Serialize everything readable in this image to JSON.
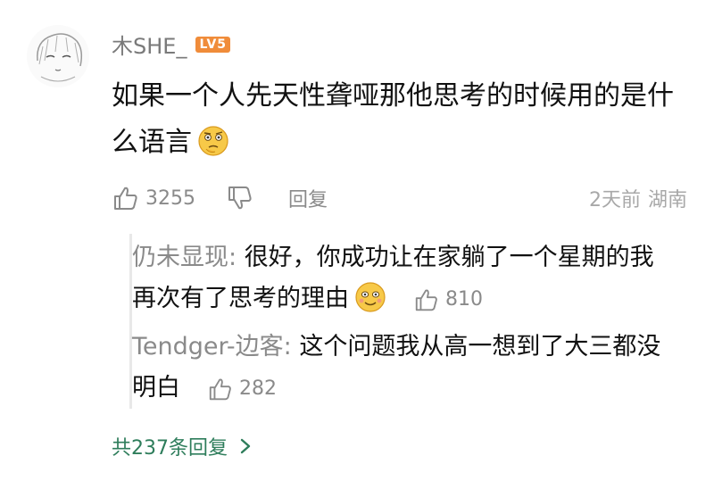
{
  "comment": {
    "username": "木SHE_",
    "level_badge": "LV5",
    "text": "如果一个人先天性聋哑那他思考的时候用的是什么语言",
    "like_count": "3255",
    "reply_label": "回复",
    "time": "2天前",
    "location": "湖南"
  },
  "replies": [
    {
      "author": "仍未显现",
      "text": "很好，你成功让在家躺了一个星期的我再次有了思考的理由",
      "like_count": "810"
    },
    {
      "author": "Tendger-边客",
      "text": "这个问题我从高一想到了大三都没明白",
      "like_count": "282"
    }
  ],
  "more_replies_label": "共237条回复",
  "colors": {
    "accent_green": "#2e7d5b",
    "badge_orange": "#f08c3a",
    "meta_gray": "#8a8a8a"
  },
  "icons": [
    "avatar-sketch",
    "thumbs-up-icon",
    "thumbs-down-icon",
    "thinking-face-emoji",
    "smile-face-emoji",
    "chevron-right-icon"
  ]
}
